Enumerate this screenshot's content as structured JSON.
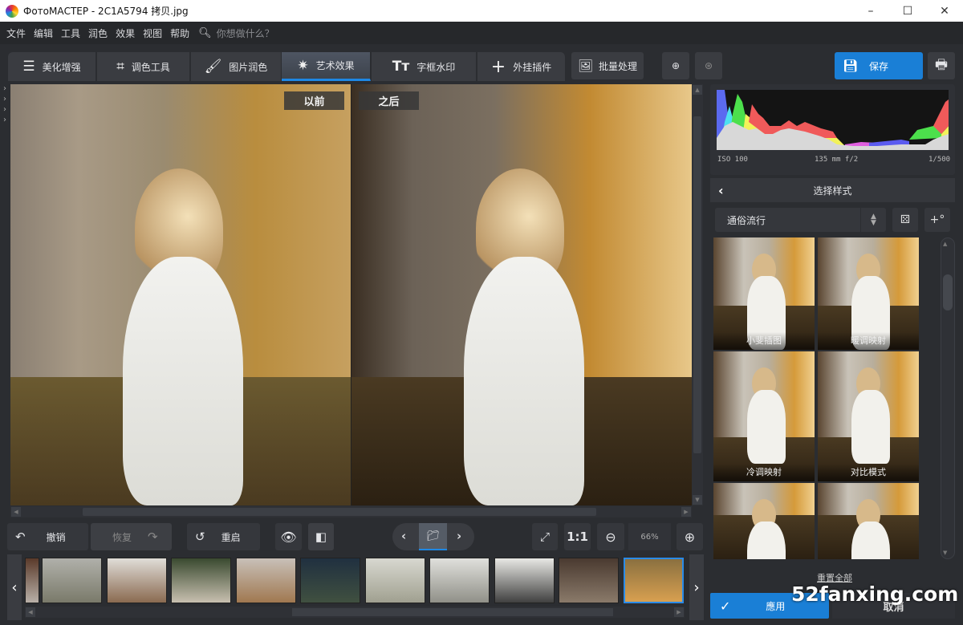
{
  "window": {
    "title": "ФотоМАСТЕР - 2C1A5794 拷贝.jpg",
    "minimize": "–",
    "maximize": "☐",
    "close": "✕"
  },
  "menu": {
    "items": [
      "文件",
      "编辑",
      "工具",
      "润色",
      "效果",
      "视图",
      "帮助"
    ],
    "search_placeholder": "你想做什么？"
  },
  "tabs": [
    {
      "label": "美化增强",
      "icon": "sliders-icon"
    },
    {
      "label": "调色工具",
      "icon": "crop-icon"
    },
    {
      "label": "图片润色",
      "icon": "brush-icon"
    },
    {
      "label": "艺术效果",
      "icon": "magic-wand-icon",
      "active": true
    },
    {
      "label": "字框水印",
      "icon": "text-icon"
    },
    {
      "label": "外挂插件",
      "icon": "plus-icon"
    }
  ],
  "toolbar": {
    "batch_label": "批量处理",
    "save_label": "保存"
  },
  "viewer": {
    "before_label": "以前",
    "after_label": "之后"
  },
  "bottom": {
    "undo": "撤销",
    "redo": "恢复",
    "reset": "重启",
    "zoom_fit": "1:1",
    "zoom_value": "66%"
  },
  "filmstrip": {
    "count": 10,
    "selected_index": 9
  },
  "histogram": {
    "iso": "ISO 100",
    "lens": "135 mm f/2",
    "shutter": "1/500"
  },
  "styles": {
    "header": "选择样式",
    "category": "通俗流行",
    "random_icon": "dice-icon",
    "add_icon": "+°",
    "presets": [
      {
        "label": "小斐插图"
      },
      {
        "label": "暖调映射"
      },
      {
        "label": "冷调映射"
      },
      {
        "label": "对比模式"
      },
      {
        "label": ""
      },
      {
        "label": ""
      }
    ],
    "reset_all": "重置全部",
    "apply": "應用",
    "cancel": "取消"
  },
  "watermark": "52fanxing.com",
  "colors": {
    "accent": "#1a7fd6",
    "bg": "#2b2d31",
    "panel": "#35373c"
  }
}
